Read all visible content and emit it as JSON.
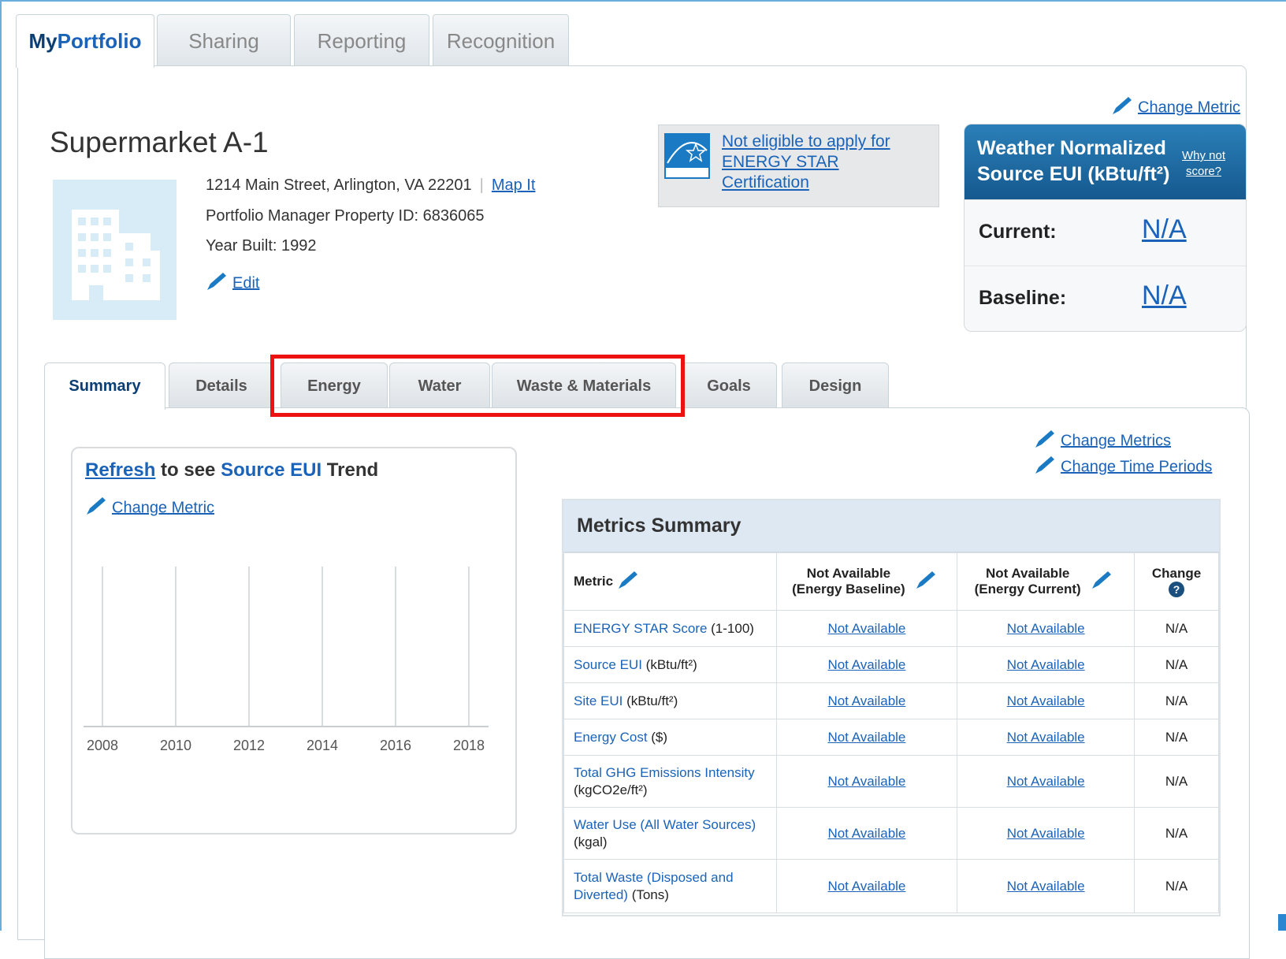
{
  "top_tabs": {
    "my": "My",
    "portfolio": "Portfolio",
    "sharing": "Sharing",
    "reporting": "Reporting",
    "recognition": "Recognition"
  },
  "property": {
    "name": "Supermarket A-1",
    "address": "1214 Main Street, Arlington, VA 22201",
    "map_link": "Map It",
    "id_line": "Portfolio Manager Property ID: 6836065",
    "year_line": "Year Built: 1992",
    "edit_link": "Edit"
  },
  "energy_star": {
    "link": "Not eligible to apply for ENERGY STAR Certification",
    "logo_text": "ENERGY STAR"
  },
  "weather": {
    "change_metric": "Change Metric",
    "title_line1": "Weather Normalized",
    "title_line2": "Source EUI (kBtu/ft²)",
    "why_line1": "Why not",
    "why_line2": "score?",
    "current_label": "Current:",
    "current_value": "N/A",
    "baseline_label": "Baseline:",
    "baseline_value": "N/A"
  },
  "section_tabs": [
    "Summary",
    "Details",
    "Energy",
    "Water",
    "Waste & Materials",
    "Goals",
    "Design"
  ],
  "trend": {
    "refresh": "Refresh",
    "to_see": " to see ",
    "source_eui": "Source EUI",
    "trend_word": " Trend",
    "change_metric": "Change Metric"
  },
  "chart_data": {
    "type": "line",
    "x_ticks": [
      "2008",
      "2010",
      "2012",
      "2014",
      "2016",
      "2018"
    ],
    "series": [],
    "grid": true
  },
  "metrics": {
    "change_metrics": "Change Metrics",
    "change_time_periods": "Change Time Periods",
    "title": "Metrics Summary",
    "headers": {
      "metric": "Metric",
      "baseline_line1": "Not Available",
      "baseline_line2": "(Energy Baseline)",
      "current_line1": "Not Available",
      "current_line2": "(Energy Current)",
      "change": "Change"
    },
    "rows": [
      {
        "name": "ENERGY STAR Score",
        "unit": " (1-100)",
        "baseline": "Not Available",
        "current": "Not Available",
        "change": "N/A"
      },
      {
        "name": "Source EUI",
        "unit": " (kBtu/ft²)",
        "baseline": "Not Available",
        "current": "Not Available",
        "change": "N/A"
      },
      {
        "name": "Site EUI",
        "unit": " (kBtu/ft²)",
        "baseline": "Not Available",
        "current": "Not Available",
        "change": "N/A"
      },
      {
        "name": "Energy Cost",
        "unit": " ($)",
        "baseline": "Not Available",
        "current": "Not Available",
        "change": "N/A"
      },
      {
        "name": "Total GHG Emissions Intensity",
        "unit": " (kgCO2e/ft²)",
        "baseline": "Not Available",
        "current": "Not Available",
        "change": "N/A"
      },
      {
        "name": "Water Use (All Water Sources)",
        "unit": " (kgal)",
        "baseline": "Not Available",
        "current": "Not Available",
        "change": "N/A"
      },
      {
        "name": "Total Waste (Disposed and Diverted)",
        "unit": " (Tons)",
        "baseline": "Not Available",
        "current": "Not Available",
        "change": "N/A"
      }
    ]
  }
}
